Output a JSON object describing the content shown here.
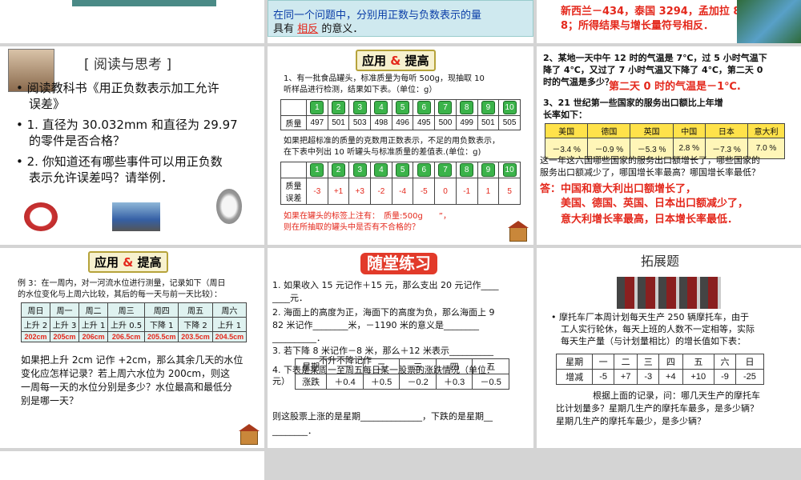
{
  "s3": {
    "lines": [
      "新西兰－434，泰国 3294，孟加拉 8",
      "8；所得结果与增长量符号相反．"
    ]
  },
  "s2": {
    "line1": "在同一个问题中，分别用正数与负数表示的量",
    "line2a": "具有",
    "line2b": "相反",
    "line2c": "的意义．"
  },
  "reading": {
    "title": "[ 阅读与思考 ]",
    "b1": "• 阅读教科书《用正负数表示加工允许",
    "b1b": "误差》",
    "b2": "• 1. 直径为 30.032mm 和直径为 29.97",
    "b2b": "的零件是否合格？",
    "b3": "• 2. 你知道还有哪些事件可以用正负数",
    "b3b": "表示允许误差吗？请举例．"
  },
  "apply1": {
    "badge_a": "应用",
    "badge_amp": "&",
    "badge_b": "提高",
    "q1": "1、有一批食品罐头，标准质量为每听 500g，现抽取 10",
    "q1b": "听样品进行检测，结果如下表。（单位：g）",
    "nums": [
      "1",
      "2",
      "3",
      "4",
      "5",
      "6",
      "7",
      "8",
      "9",
      "10"
    ],
    "mass_label": "质量",
    "masses": [
      "497",
      "501",
      "503",
      "498",
      "496",
      "495",
      "500",
      "499",
      "501",
      "505"
    ],
    "q2": "如果把超标准的质量的克数用正数表示，不足的用负数表示，",
    "q2b": "在下表中列出 10 听罐头与标准质量的差值表.(单位：g)",
    "diff_label_a": "质量",
    "diff_label_b": "误差",
    "diffs": [
      "-3",
      "+1",
      "+3",
      "-2",
      "-4",
      "-5",
      "0",
      "-1",
      "1",
      "5"
    ],
    "q3": "如果在罐头的标签上注有：　质量:500g　　”，",
    "q3b": "则在所抽取的罐头中是否有不合格的？"
  },
  "s6": {
    "q2": "2、某地一天中午 12 时的气温是 7℃，过 5 小时气温下",
    "q2b": "降了 4℃，又过了 7 小时气温又下降了 4℃，第二天 0",
    "q2c": "时的气温是多少？",
    "ans2": "第二天 0 时的气温是－1℃.",
    "q3": "3、21 世纪第一些国家的服务出口额比上年增",
    "q3b": "长率如下：",
    "countries": [
      "美国",
      "德国",
      "英国",
      "中国",
      "日本",
      "意大利"
    ],
    "rates": [
      "－3.4 %",
      "－0.9 %",
      "－5.3 %",
      "2.8 %",
      "－7.3 %",
      "7.0 %"
    ],
    "q3c": "这一年这六国哪些国家的服务出口额增长了，哪些国家的",
    "q3d": "服务出口额减少了，哪国增长率最高？哪国增长率最低？",
    "ans_a": "答：中国和意大利出口额增长了，",
    "ans_b": "美国、德国、英国、日本出口额减少了，",
    "ans_c": "意大利增长率最高，日本增长率最低．"
  },
  "apply2": {
    "badge_a": "应用",
    "badge_amp": "&",
    "badge_b": "提高",
    "ex": "例 3：在一周内，对一河流水位进行测量，记录如下（周日",
    "ex_b": "的水位变化与上周六比较，其后的每一天与前一天比较）：",
    "days": [
      "周日",
      "周一",
      "周二",
      "周三",
      "周四",
      "周五",
      "周六"
    ],
    "changes": [
      "上升 2",
      "上升 3",
      "上升 1",
      "上升 0.5",
      "下降 1",
      "下降 2",
      "上升 1"
    ],
    "levels": [
      "202cm",
      "205cm",
      "206cm",
      "206.5cm",
      "205.5cm",
      "203.5cm",
      "204.5cm"
    ],
    "q": "如果把上升 2cm 记作 +2cm，那么其余几天的水位",
    "q_b": "变化应怎样记录？若上周六水位为 200cm，则这",
    "q_c": "一周每一天的水位分别是多少？水位最高和最低分",
    "q_d": "别是哪一天？"
  },
  "practice": {
    "title": "随堂练习",
    "q1": "1. 如果收入 15 元记作＋15 元，那么支出 20 元记作____",
    "q1b": "____元．",
    "q2": "2. 海面上的高度为正，海面下的高度为负，那么海面上 9",
    "q2b": "82 米记作________米，－1190 米的意义是________",
    "q2c": "__________．",
    "q3": "3. 若下降 8 米记作－8 米，那么＋12 米表示__________",
    "q3b": "不升不降记作",
    "q4": "4. 下表是某周一至周五每日某一股票的涨跌情况（单位：",
    "q4b": "元）",
    "st_head": [
      "星期",
      "一",
      "二",
      "三",
      "四",
      "五"
    ],
    "st_row": [
      "涨跌",
      "＋0.4",
      "＋0.5",
      "－0.2",
      "＋0.3",
      "－0.5"
    ],
    "q5": "则这股票上涨的是星期______________，下跌的是星期__",
    "q5b": "________．"
  },
  "ext": {
    "title": "拓展题",
    "p1": "• 摩托车厂本周计划每天生产 250 辆摩托车，由于",
    "p1b": "工人实行轮休，每天上班的人数不一定相等，实际",
    "p1c": "每天生产量（与计划量相比）的增长值如下表：",
    "head": [
      "星期",
      "一",
      "二",
      "三",
      "四",
      "五",
      "六",
      "日"
    ],
    "row": [
      "增减",
      "-5",
      "+7",
      "-3",
      "+4",
      "+10",
      "-9",
      "-25"
    ],
    "q": "根据上面的记录，问：哪几天生产的摩托车",
    "q_b": "比计划量多？星期几生产的摩托车最多，是多少辆？",
    "q_c": "星期几生产的摩托车最少，是多少辆？"
  }
}
